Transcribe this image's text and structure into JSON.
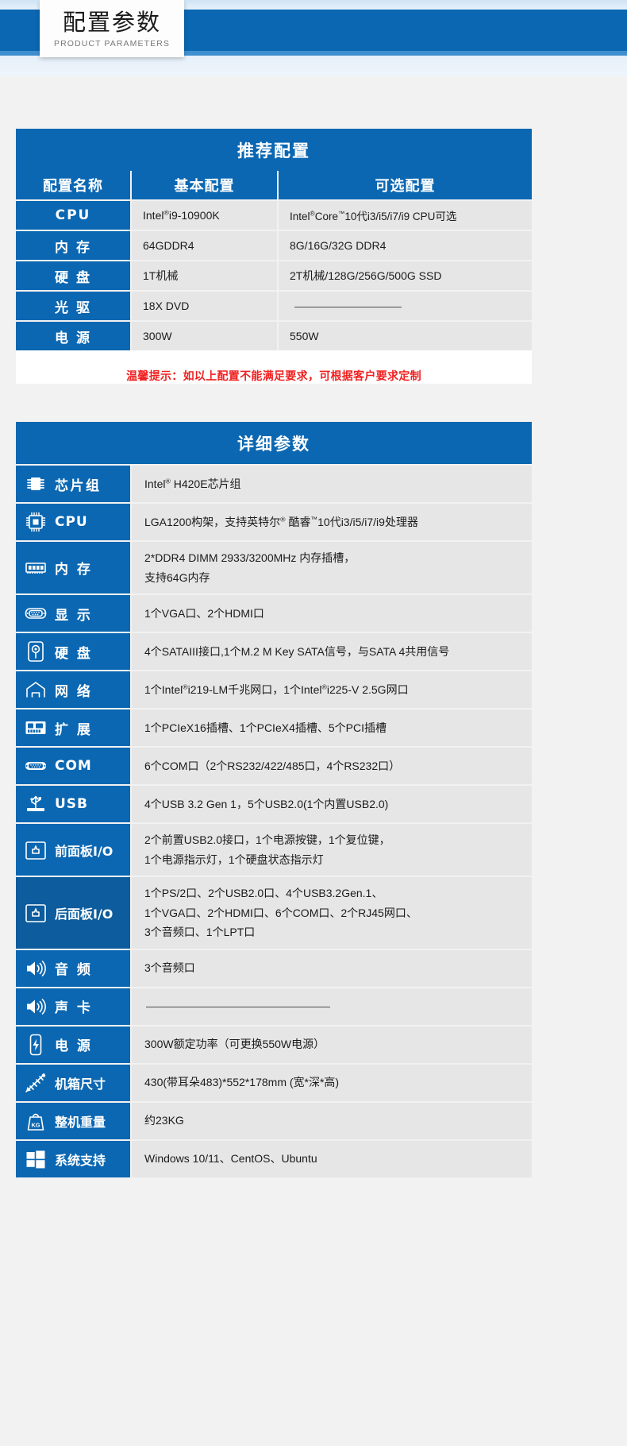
{
  "header": {
    "title_cn": "配置参数",
    "title_en": "PRODUCT PARAMETERS",
    "accent_color": "#0b67b2",
    "accent_light": "#3f8fcf"
  },
  "recommended": {
    "section_title": "推荐配置",
    "columns": [
      "配置名称",
      "基本配置",
      "可选配置"
    ],
    "rows": [
      {
        "name": "CPU",
        "basic": "Intel®i9-10900K",
        "optional": "Intel®Core™10代i3/i5/i7/i9 CPU可选",
        "optional_is_dash": false
      },
      {
        "name": "内 存",
        "basic": "64GDDR4",
        "optional": "8G/16G/32G DDR4",
        "optional_is_dash": false
      },
      {
        "name": "硬 盘",
        "basic": "1T机械",
        "optional": "2T机械/128G/256G/500G SSD",
        "optional_is_dash": false
      },
      {
        "name": "光 驱",
        "basic": "18X DVD",
        "optional": "",
        "optional_is_dash": true
      },
      {
        "name": "电 源",
        "basic": "300W",
        "optional": "550W",
        "optional_is_dash": false
      }
    ],
    "notice": "温馨提示：如以上配置不能满足要求，可根据客户要求定制",
    "notice_color": "#f02020"
  },
  "detailed": {
    "section_title": "详细参数",
    "rows": [
      {
        "icon": "chipset-icon",
        "label": "芯片组",
        "lines": [
          "Intel® H420E芯片组"
        ]
      },
      {
        "icon": "cpu-icon",
        "label": "CPU",
        "lines": [
          "LGA1200构架，支持英特尔® 酷睿™10代i3/i5/i7/i9处理器"
        ]
      },
      {
        "icon": "memory-icon",
        "label": "内 存",
        "lines": [
          "2*DDR4 DIMM 2933/3200MHz 内存插槽，",
          "支持64G内存"
        ]
      },
      {
        "icon": "vga-display-icon",
        "label": "显 示",
        "lines": [
          "1个VGA口、2个HDMI口"
        ]
      },
      {
        "icon": "harddisk-icon",
        "label": "硬 盘",
        "lines": [
          "4个SATAIII接口,1个M.2 M Key SATA信号，与SATA 4共用信号"
        ]
      },
      {
        "icon": "network-icon",
        "label": "网 络",
        "lines": [
          "1个Intel®i219-LM千兆网口，1个Intel®i225-V 2.5G网口"
        ]
      },
      {
        "icon": "expansion-slot-icon",
        "label": "扩 展",
        "lines": [
          "1个PCIeX16插槽、1个PCIeX4插槽、5个PCI插槽"
        ]
      },
      {
        "icon": "serial-port-icon",
        "label": "COM",
        "lines": [
          "6个COM口（2个RS232/422/485口，4个RS232口）"
        ]
      },
      {
        "icon": "usb-icon",
        "label": "USB",
        "lines": [
          "4个USB 3.2 Gen 1，5个USB2.0(1个内置USB2.0)"
        ]
      },
      {
        "icon": "front-panel-icon",
        "label": "前面板I/O",
        "lines": [
          "2个前置USB2.0接口，1个电源按键，1个复位键，",
          "1个电源指示灯，1个硬盘状态指示灯"
        ]
      },
      {
        "icon": "rear-panel-icon",
        "label": "后面板I/O",
        "lines": [
          "1个PS/2口、2个USB2.0口、4个USB3.2Gen.1、",
          "1个VGA口、2个HDMI口、6个COM口、2个RJ45网口、",
          "3个音频口、1个LPT口"
        ]
      },
      {
        "icon": "audio-icon",
        "label": "音 频",
        "lines": [
          "3个音频口"
        ]
      },
      {
        "icon": "soundcard-icon",
        "label": "声 卡",
        "lines": [
          ""
        ],
        "is_dash": true
      },
      {
        "icon": "power-icon",
        "label": "电 源",
        "lines": [
          "300W额定功率（可更换550W电源）"
        ]
      },
      {
        "icon": "dimension-icon",
        "label": "机箱尺寸",
        "lines": [
          "430(带耳朵483)*552*178mm (宽*深*高)"
        ]
      },
      {
        "icon": "weight-icon",
        "label": "整机重量",
        "lines": [
          "约23KG"
        ]
      },
      {
        "icon": "windows-icon",
        "label": "系统支持",
        "lines": [
          "Windows 10/11、CentOS、Ubuntu"
        ]
      }
    ]
  }
}
